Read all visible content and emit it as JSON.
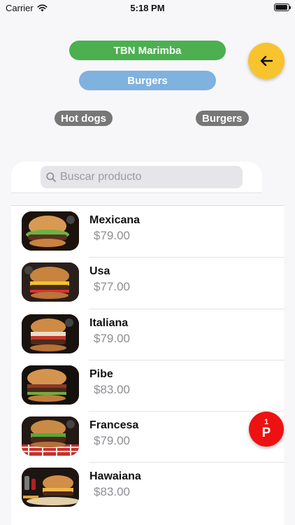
{
  "status": {
    "carrier": "Carrier",
    "time": "5:18 PM"
  },
  "header": {
    "store": "TBN Marimba",
    "category": "Burgers"
  },
  "filters": [
    {
      "label": "Hot dogs"
    },
    {
      "label": "Burgers"
    }
  ],
  "search": {
    "placeholder": "Buscar producto",
    "value": ""
  },
  "products": [
    {
      "name": "Mexicana",
      "price": "$79.00"
    },
    {
      "name": "Usa",
      "price": "$77.00"
    },
    {
      "name": "Italiana",
      "price": "$79.00"
    },
    {
      "name": "Pibe",
      "price": "$83.00"
    },
    {
      "name": "Francesa",
      "price": "$79.00"
    },
    {
      "name": "Hawaiana",
      "price": "$83.00"
    }
  ],
  "cart": {
    "count": "1",
    "letter": "P"
  },
  "colors": {
    "store_pill": "#4caf50",
    "category_pill": "#7fb2de",
    "chip": "#777777",
    "back_button": "#f7c42e",
    "cart_button": "#ee1111"
  },
  "icons": {
    "back": "arrow-left-icon",
    "search": "search-icon",
    "wifi": "wifi-icon",
    "battery": "battery-icon"
  }
}
